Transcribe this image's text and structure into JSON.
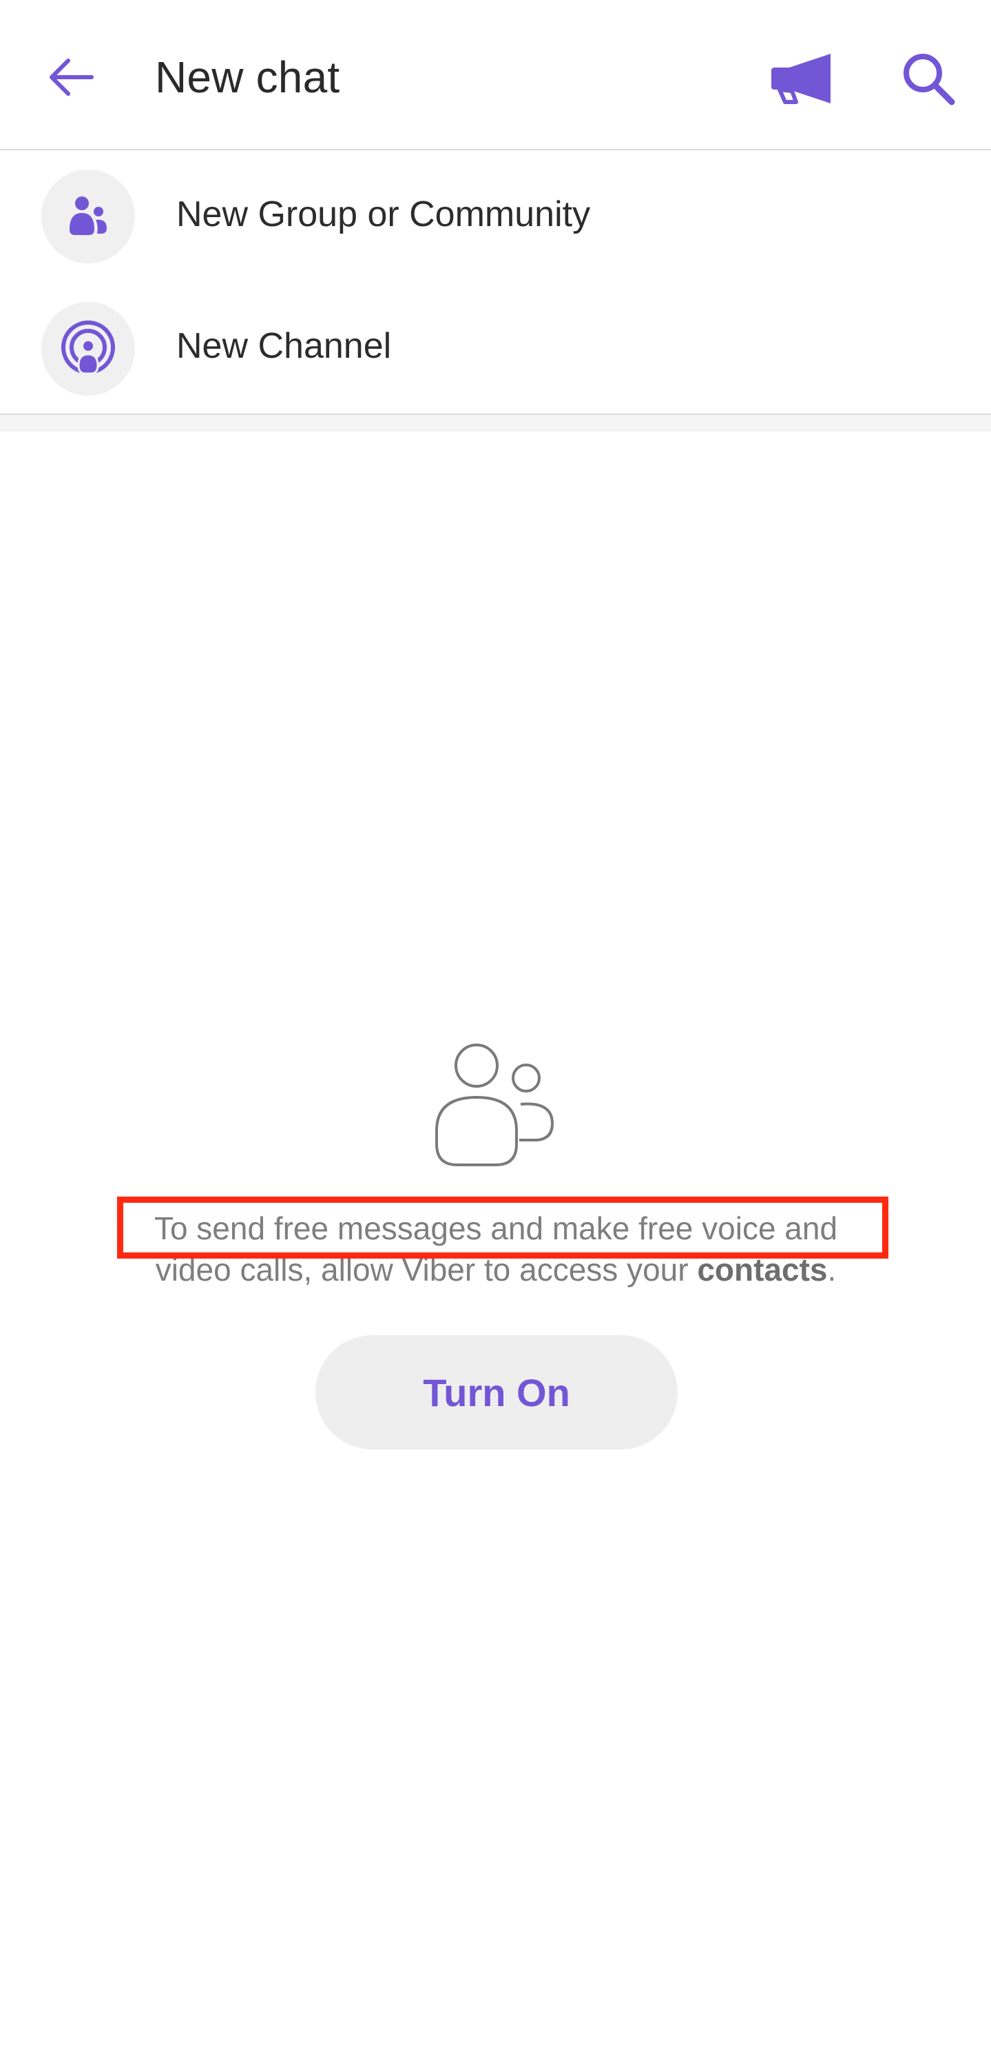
{
  "header": {
    "title": "New chat",
    "back_icon": "arrow-left-icon",
    "megaphone_icon": "megaphone-icon",
    "search_icon": "search-icon"
  },
  "list": {
    "items": [
      {
        "label": "New Group or Community",
        "icon": "group-people-icon"
      },
      {
        "label": "New Channel",
        "icon": "broadcast-channel-icon"
      }
    ]
  },
  "empty_state": {
    "icon": "contacts-people-icon",
    "message_line1": "To send free messages and make free voice and",
    "message_line2_prefix": "video calls, allow Viber to access your ",
    "message_line2_bold": "contacts",
    "message_line2_suffix": ".",
    "button_label": "Turn On"
  },
  "colors": {
    "accent": "#7356d6",
    "highlight": "#ff2a12",
    "text_primary": "#2a2a2a",
    "text_secondary": "#7e7e7e",
    "avatar_bg": "#f0f0f0",
    "button_bg": "#eeeeee"
  }
}
